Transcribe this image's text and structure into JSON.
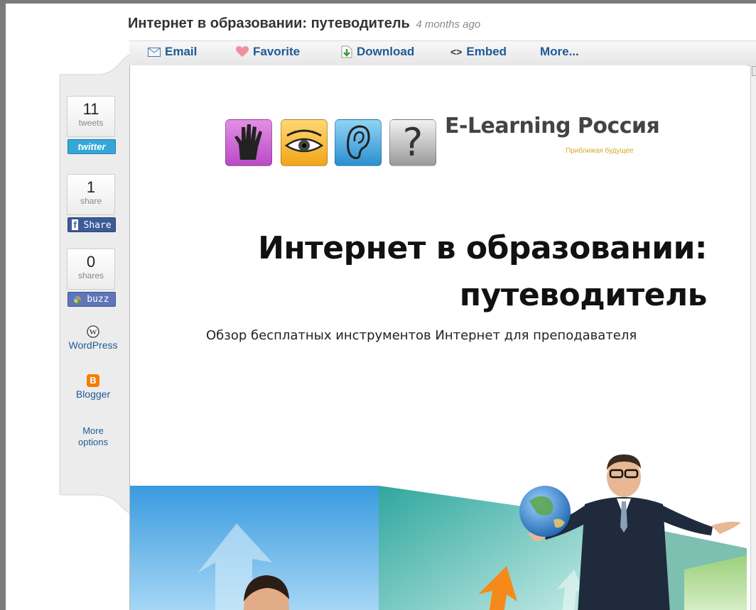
{
  "header": {
    "title": "Интернет в образовании: путеводитель",
    "time_ago": "4 months ago"
  },
  "toolbar": {
    "email": "Email",
    "favorite": "Favorite",
    "download": "Download",
    "embed": "Embed",
    "more": "More..."
  },
  "sidebar": {
    "twitter": {
      "count": "11",
      "count_label": "tweets",
      "button": "twitter"
    },
    "facebook": {
      "count": "1",
      "count_label": "share",
      "button": "Share"
    },
    "buzz": {
      "count": "0",
      "count_label": "shares",
      "button": "buzz"
    },
    "wordpress": "WordPress",
    "blogger": "Blogger",
    "more_options_line1": "More",
    "more_options_line2": "options"
  },
  "slide": {
    "brand": "E-Learning Россия",
    "tagline": "Приближая будущее",
    "heading_line1": "Интернет в образовании:",
    "heading_line2": "путеводитель",
    "subtitle": "Обзор бесплатных инструментов Интернет для преподавателя"
  },
  "colors": {
    "link_blue": "#1e5a96",
    "twitter_blue": "#34a7d8",
    "facebook_blue": "#3b5b98",
    "blogger_orange": "#f57d00",
    "tagline_gold": "#d6a928"
  },
  "icons": {
    "email": "envelope-icon",
    "favorite": "heart-icon",
    "download": "download-arrow-icon",
    "embed": "code-brackets-icon",
    "wordpress": "wordpress-logo-icon",
    "blogger": "blogger-logo-icon"
  }
}
